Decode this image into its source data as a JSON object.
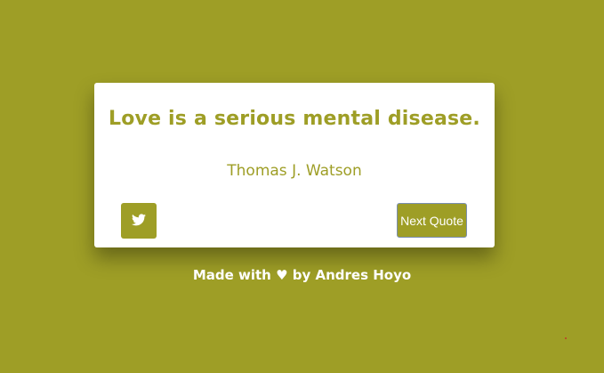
{
  "quote": {
    "text": "Love is a serious mental disease.",
    "author": "Thomas J. Watson"
  },
  "buttons": {
    "tweet_icon": "twitter-icon",
    "next_label": "Next Quote"
  },
  "footer": {
    "text": "Made with ♥ by Andres Hoyo"
  },
  "colors": {
    "background": "#9e9e26",
    "card": "#ffffff",
    "accent": "#9e9e26",
    "text_light": "#ffffff"
  }
}
